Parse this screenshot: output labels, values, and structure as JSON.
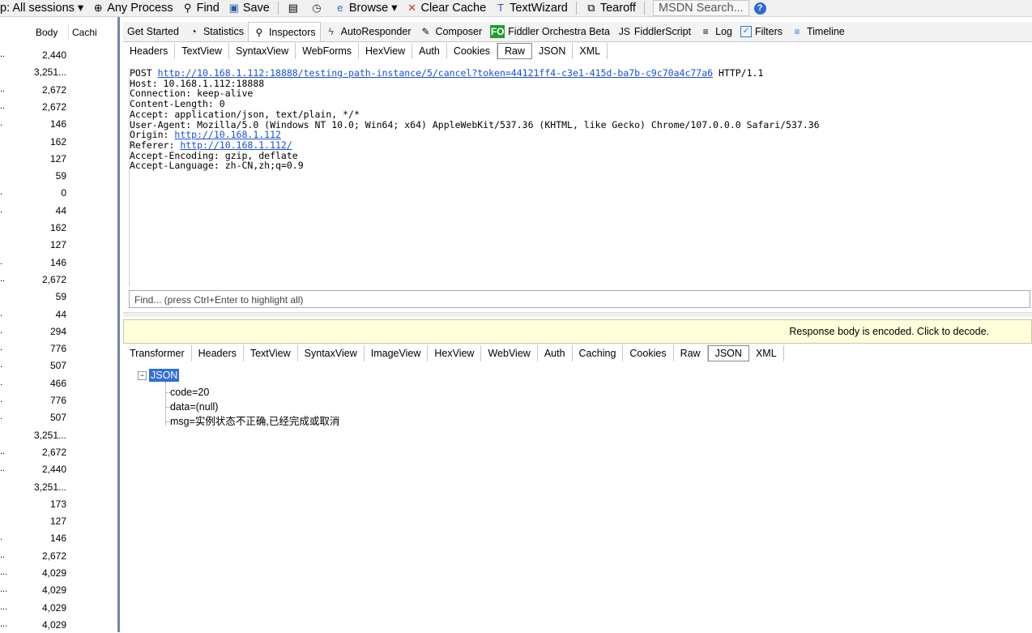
{
  "toolbar": {
    "items": [
      {
        "label": "p: All sessions ▾",
        "icon": ""
      },
      {
        "label": "Any Process",
        "icon": "crosshair-icon"
      },
      {
        "label": "Find",
        "icon": "binoculars-icon"
      },
      {
        "label": "Save",
        "icon": "save-icon"
      },
      {
        "label": "",
        "icon": "paste-icon"
      },
      {
        "label": "",
        "icon": "clock-icon"
      },
      {
        "label": "Browse ▾",
        "icon": "ie-icon"
      },
      {
        "label": "Clear Cache",
        "icon": "clear-cache-icon"
      },
      {
        "label": "TextWizard",
        "icon": "text-wizard-icon"
      },
      {
        "label": "Tearoff",
        "icon": "tearoff-icon"
      }
    ],
    "msdn_placeholder": "MSDN Search...",
    "help_glyph": "?"
  },
  "session_list": {
    "headers": {
      "body": "Body",
      "caching": "Cachi"
    },
    "rows": [
      {
        "prefix": "..",
        "body": "2,440"
      },
      {
        "prefix": "",
        "body": "3,251..."
      },
      {
        "prefix": "..",
        "body": "2,672"
      },
      {
        "prefix": "..",
        "body": "2,672"
      },
      {
        "prefix": ".",
        "body": "146"
      },
      {
        "prefix": "",
        "body": "162"
      },
      {
        "prefix": "",
        "body": "127"
      },
      {
        "prefix": "",
        "body": "59"
      },
      {
        "prefix": ".",
        "body": "0"
      },
      {
        "prefix": ".",
        "body": "44"
      },
      {
        "prefix": "",
        "body": "162"
      },
      {
        "prefix": "",
        "body": "127"
      },
      {
        "prefix": ".",
        "body": "146"
      },
      {
        "prefix": "..",
        "body": "2,672"
      },
      {
        "prefix": "",
        "body": "59"
      },
      {
        "prefix": ".",
        "body": "44"
      },
      {
        "prefix": ".",
        "body": "294"
      },
      {
        "prefix": ".",
        "body": "776"
      },
      {
        "prefix": ".",
        "body": "507"
      },
      {
        "prefix": ".",
        "body": "466"
      },
      {
        "prefix": ".",
        "body": "776"
      },
      {
        "prefix": ".",
        "body": "507"
      },
      {
        "prefix": "",
        "body": "3,251..."
      },
      {
        "prefix": "..",
        "body": "2,672"
      },
      {
        "prefix": "..",
        "body": "2,440"
      },
      {
        "prefix": "",
        "body": "3,251..."
      },
      {
        "prefix": "",
        "body": "173"
      },
      {
        "prefix": "",
        "body": "127"
      },
      {
        "prefix": ".",
        "body": "146"
      },
      {
        "prefix": "..",
        "body": "2,672"
      },
      {
        "prefix": "...",
        "body": "4,029"
      },
      {
        "prefix": "...",
        "body": "4,029"
      },
      {
        "prefix": "...",
        "body": "4,029"
      },
      {
        "prefix": "...",
        "body": "4,029"
      }
    ]
  },
  "inspector_tabs": [
    {
      "label": "Get Started",
      "icon": "",
      "active": false
    },
    {
      "label": "Statistics",
      "icon": "stopwatch-icon",
      "active": false
    },
    {
      "label": "Inspectors",
      "icon": "magnifier-icon",
      "active": true
    },
    {
      "label": "AutoResponder",
      "icon": "lightning-icon",
      "active": false
    },
    {
      "label": "Composer",
      "icon": "pencil-icon",
      "active": false
    },
    {
      "label": "Fiddler Orchestra Beta",
      "icon": "fo-icon",
      "active": false
    },
    {
      "label": "FiddlerScript",
      "icon": "script-icon",
      "active": false
    },
    {
      "label": "Log",
      "icon": "log-icon",
      "active": false
    },
    {
      "label": "Filters",
      "icon": "checkbox-icon",
      "active": false
    },
    {
      "label": "Timeline",
      "icon": "timeline-icon",
      "active": false
    }
  ],
  "request_tabs": [
    {
      "label": "Headers",
      "active": false
    },
    {
      "label": "TextView",
      "active": false
    },
    {
      "label": "SyntaxView",
      "active": false
    },
    {
      "label": "WebForms",
      "active": false
    },
    {
      "label": "HexView",
      "active": false
    },
    {
      "label": "Auth",
      "active": false
    },
    {
      "label": "Cookies",
      "active": false
    },
    {
      "label": "Raw",
      "active": true
    },
    {
      "label": "JSON",
      "active": false
    },
    {
      "label": "XML",
      "active": false
    }
  ],
  "raw_request": {
    "method": "POST ",
    "url": "http://10.168.1.112:18888/testing-path-instance/5/cancel?token=44121ff4-c3e1-415d-ba7b-c9c70a4c77a6",
    "protocol": " HTTP/1.1",
    "host": "Host: 10.168.1.112:18888",
    "connection": "Connection: keep-alive",
    "content_length": "Content-Length: 0",
    "accept": "Accept: application/json, text/plain, */*",
    "user_agent": "User-Agent: Mozilla/5.0 (Windows NT 10.0; Win64; x64) AppleWebKit/537.36 (KHTML, like Gecko) Chrome/107.0.0.0 Safari/537.36",
    "origin_key": "Origin: ",
    "origin_url": "http://10.168.1.112",
    "referer_key": "Referer: ",
    "referer_url": "http://10.168.1.112/",
    "accept_encoding": "Accept-Encoding: gzip, deflate",
    "accept_language": "Accept-Language: zh-CN,zh;q=0.9"
  },
  "find_placeholder": "Find... (press Ctrl+Enter to highlight all)",
  "response_banner": "Response body is encoded. Click to decode.",
  "response_tabs": [
    {
      "label": "Transformer",
      "active": false
    },
    {
      "label": "Headers",
      "active": false
    },
    {
      "label": "TextView",
      "active": false
    },
    {
      "label": "SyntaxView",
      "active": false
    },
    {
      "label": "ImageView",
      "active": false
    },
    {
      "label": "HexView",
      "active": false
    },
    {
      "label": "WebView",
      "active": false
    },
    {
      "label": "Auth",
      "active": false
    },
    {
      "label": "Caching",
      "active": false
    },
    {
      "label": "Cookies",
      "active": false
    },
    {
      "label": "Raw",
      "active": false
    },
    {
      "label": "JSON",
      "active": true
    },
    {
      "label": "XML",
      "active": false
    }
  ],
  "json_tree": {
    "toggle": "−",
    "root": "JSON",
    "nodes": [
      "code=20",
      "data=(null)",
      "msg=实例状态不正确,已经完成或取消"
    ]
  }
}
